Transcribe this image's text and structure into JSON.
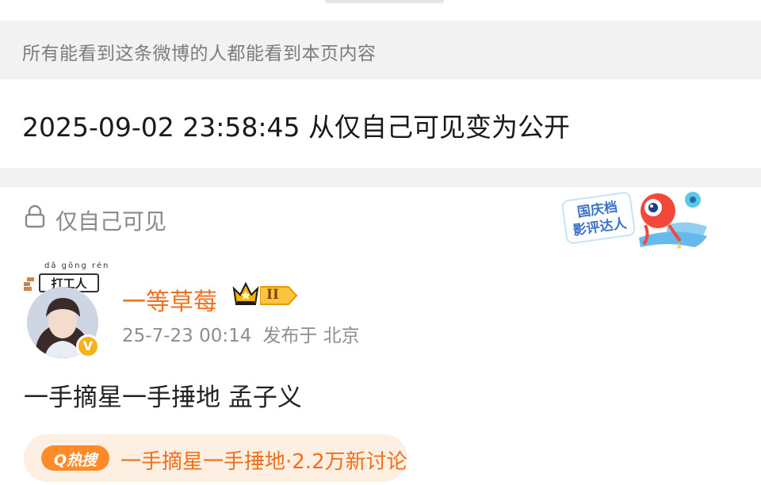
{
  "visibility_notice": "所有能看到这条微博的人都能看到本页内容",
  "change_record": "2025-09-02 23:58:45 从仅自己可见变为公开",
  "visibility": {
    "label": "仅自己可见",
    "icon": "lock-icon"
  },
  "badge": {
    "line1": "国庆档",
    "line2": "影评达人"
  },
  "post": {
    "avatar_pinyin": "dǎ gōng rén",
    "avatar_tag": "打工人",
    "verified_mark": "V",
    "username": "一等草莓",
    "level": "II",
    "timestamp": "25-7-23 00:14",
    "location": "发布于 北京",
    "content": "一手摘星一手捶地 孟子义",
    "hot_search": {
      "tag": "Q热搜",
      "text": "一手摘星一手捶地·2.2万新讨论"
    }
  },
  "colors": {
    "accent_orange": "#f06f1c",
    "gray_bg": "#f2f2f2",
    "hot_pill_bg": "#fdefe1"
  }
}
